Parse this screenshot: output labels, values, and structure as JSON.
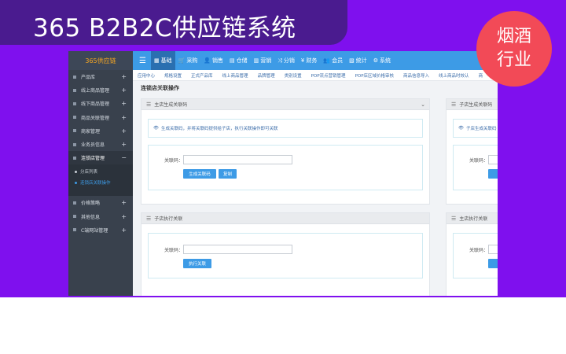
{
  "banner": {
    "title": "365 B2B2C供应链系统"
  },
  "badge": {
    "line1": "烟酒",
    "line2": "行业"
  },
  "app": {
    "logo": "365供应链",
    "nav": [
      {
        "label": "基础",
        "icon": "grid-icon",
        "glyph": "▦"
      },
      {
        "label": "采购",
        "icon": "cart-icon",
        "glyph": "🛒"
      },
      {
        "label": "销售",
        "icon": "user-icon",
        "glyph": "👤"
      },
      {
        "label": "仓储",
        "icon": "warehouse-icon",
        "glyph": "▤"
      },
      {
        "label": "营销",
        "icon": "marketing-icon",
        "glyph": "▥"
      },
      {
        "label": "分销",
        "icon": "shuffle-icon",
        "glyph": "⤨"
      },
      {
        "label": "财务",
        "icon": "yen-icon",
        "glyph": "¥"
      },
      {
        "label": "会员",
        "icon": "users-icon",
        "glyph": "👥"
      },
      {
        "label": "统计",
        "icon": "chart-icon",
        "glyph": "▧"
      },
      {
        "label": "系统",
        "icon": "cogs-icon",
        "glyph": "⚙"
      }
    ],
    "tabs": [
      "应用中心",
      "规格设置",
      "正式产品库",
      "线上商品管理",
      "品牌管理",
      "类别设置",
      "POP流点营销管理",
      "POP店区域价格审核",
      "商品信息导入",
      "线上商品时效认",
      "商"
    ],
    "sidebar": {
      "items_top": [
        "产品库",
        "线上商品管理",
        "线下商品管理",
        "商品关联管理",
        "商家管理",
        "业务员信息"
      ],
      "open_item": "连锁店管理",
      "sub_items": [
        "分店列表",
        "连锁店关联操作"
      ],
      "items_bottom": [
        "价格策略",
        "其他信息",
        "C端网站管理"
      ]
    },
    "page_title": "连锁店关联操作",
    "panels": {
      "main_generate": {
        "title": "主店生成关联码",
        "info": "生成关联码，并将关联码提供给子店，执行关联操作即可关联",
        "label": "关联码：",
        "buttons": [
          "生成关联码",
          "复制"
        ]
      },
      "sub_generate": {
        "title": "子店生成关联码",
        "info": "子店生成关联码",
        "label": "关联码："
      },
      "sub_execute": {
        "title": "子店执行关联",
        "label": "关联码：",
        "button": "执行关联"
      },
      "main_execute": {
        "title": "主店执行关联",
        "label": "关联码："
      }
    }
  }
}
